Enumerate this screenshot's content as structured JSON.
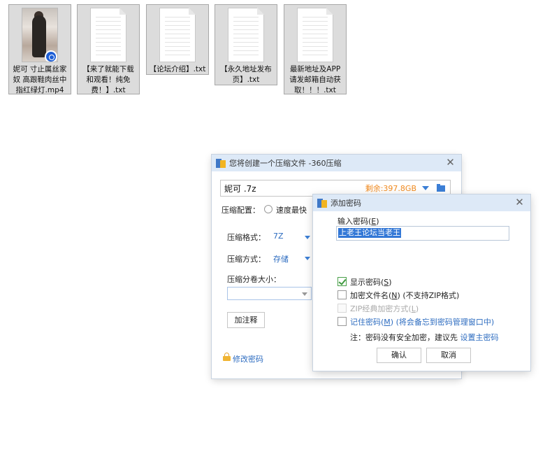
{
  "desktop": {
    "files": [
      {
        "name": "妮可 寸止属丝家奴 高跟鞋肉丝中指红绿灯.mp4",
        "type": "video",
        "icon": "video-thumbnail-icon"
      },
      {
        "name": "【来了就能下载和观看！纯免费！】.txt",
        "type": "text",
        "icon": "text-file-icon"
      },
      {
        "name": "【论坛介绍】.txt",
        "type": "text",
        "icon": "text-file-icon"
      },
      {
        "name": "【永久地址发布页】.txt",
        "type": "text",
        "icon": "text-file-icon"
      },
      {
        "name": "最新地址及APP请发邮箱自动获取！！！.txt",
        "type": "text",
        "icon": "text-file-icon"
      }
    ]
  },
  "compress_dialog": {
    "title": "您将创建一个压缩文件 -360压缩",
    "filename": "妮可 .7z",
    "free_space": "剩余:397.8GB",
    "config_label": "压缩配置：",
    "config_option": "速度最快",
    "format_label": "压缩格式：",
    "format_value": "7Z",
    "method_label": "压缩方式：",
    "method_value": "存储",
    "split_label": "压缩分卷大小：",
    "split_value": "",
    "comment_button": "加注释",
    "change_password_link": "修改密码"
  },
  "password_dialog": {
    "title": "添加密码",
    "input_label_prefix": "输入密码(",
    "input_label_key": "E",
    "input_label_suffix": ")",
    "password_value": "上老王论坛当老王",
    "show_password": {
      "prefix": "显示密码(",
      "key": "S",
      "suffix": ")",
      "checked": true
    },
    "encrypt_names": {
      "prefix": "加密文件名(",
      "key": "N",
      "suffix": ")",
      "note": " (不支持ZIP格式)",
      "checked": false
    },
    "zip_classic": {
      "prefix": "ZIP经典加密方式(",
      "key": "L",
      "suffix": ")",
      "checked": false,
      "disabled": true
    },
    "remember_password": {
      "prefix": "记住密码(",
      "key": "M",
      "suffix": ")",
      "note": " (将会备忘到密码管理窗口中)",
      "checked": false
    },
    "hint_text": "注：密码没有安全加密，建议先 ",
    "hint_link": "设置主密码",
    "ok_button": "确认",
    "cancel_button": "取消"
  },
  "colors": {
    "accent_blue": "#2d6cc0",
    "free_space_orange": "#f08a20",
    "titlebar_bg": "#dde9f7",
    "selection": "#3277d6"
  }
}
